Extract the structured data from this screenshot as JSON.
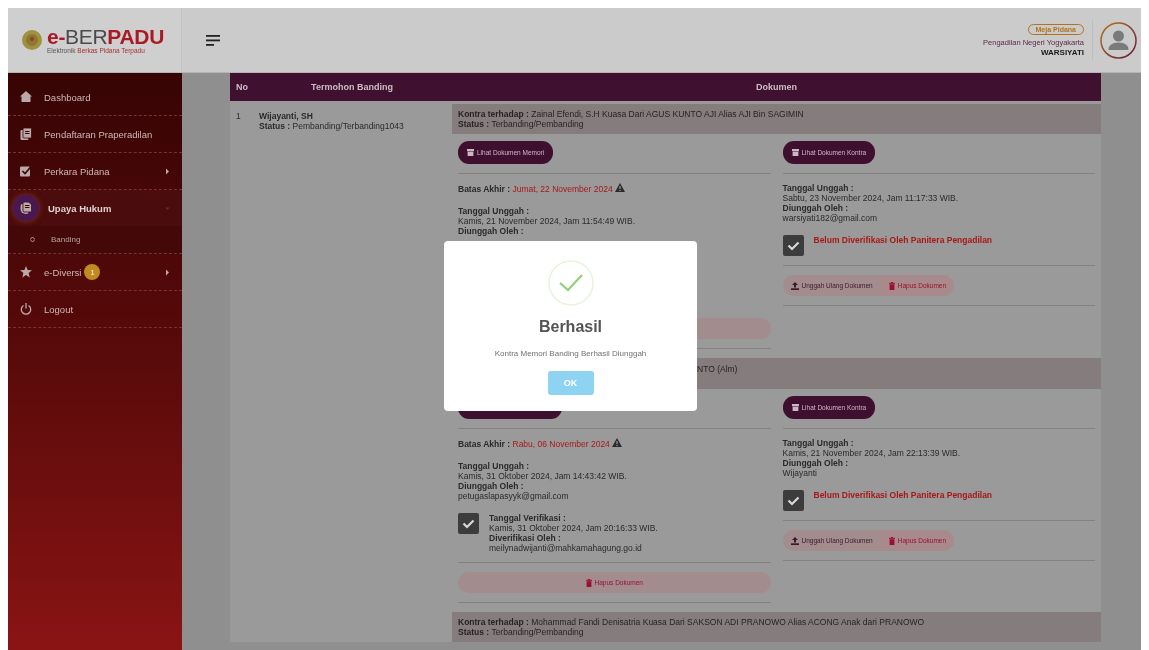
{
  "header": {
    "logo_title": [
      "e-",
      "BER",
      "PADU"
    ],
    "logo_subtitle": [
      "Elektronik ",
      "Berkas Pidana",
      " Terpadu"
    ],
    "role_badge": "Meja Pidana",
    "court": "Pengadilan Negeri Yogyakarta",
    "user": "WARSIYATI"
  },
  "sidebar": {
    "items": [
      {
        "label": "Dashboard",
        "kind": "home",
        "selected": false
      },
      {
        "label": "Pendaftaran Praperadilan",
        "kind": "docs",
        "selected": false
      },
      {
        "label": "Perkara Pidana",
        "kind": "edit",
        "selected": false,
        "expanded": false
      },
      {
        "label": "Upaya Hukum",
        "kind": "docs",
        "selected": true,
        "expanded": true,
        "children": [
          {
            "label": "Banding",
            "selected": false
          }
        ]
      },
      {
        "label": "e-Diversi",
        "kind": "star",
        "selected": false,
        "expanded": false,
        "badge": "1"
      },
      {
        "label": "Logout",
        "kind": "power",
        "selected": false
      }
    ]
  },
  "table": {
    "columns": [
      "No",
      "Termohon Banding",
      "Dokumen"
    ],
    "rows": [
      {
        "no": "1",
        "name": "Wijayanti, SH",
        "status_label": "Status :",
        "status": "Pembanding/Terbanding1043",
        "sections": [
          {
            "kontra_label": "Kontra terhadap :",
            "kontra": "Zainal Efendi, S.H Kuasa Dari AGUS KUNTO AJI Alias AJI Bin SAGIMIN",
            "status_label": "Status :",
            "status": "Terbanding/Pembanding",
            "memori": {
              "button": "Lihat Dokumen Memori",
              "deadline_label": "Batas Akhir :",
              "deadline": "Jumat, 22 November 2024",
              "upload_label": "Tanggal Unggah :",
              "upload": "Kamis, 21 November 2024, Jam 11:54:49 WIB.",
              "by_label": "Diunggah Oleh :",
              "delete_bar": true
            },
            "kontra_doc": {
              "button": "Lihat Dokumen Kontra",
              "upload_label": "Tanggal Unggah :",
              "upload": "Sabtu, 23 November 2024, Jam 11:17:33 WIB.",
              "by_label": "Diunggah Oleh :",
              "by": "warsiyati182@gmail.com",
              "unverified": "Belum Diverifikasi Oleh Panitera Pengadilan",
              "reupload": "Unggah Ulang Dokumen",
              "delete": "Hapus Dokumen"
            }
          },
          {
            "kontra": "NTO (Alm)",
            "obscured": true,
            "memori": {
              "deadline_label": "Batas Akhir :",
              "deadline": "Rabu, 06 November 2024",
              "upload_label": "Tanggal Unggah :",
              "upload": "Kamis, 31 Oktober 2024, Jam 14:43:42 WIB.",
              "by_label": "Diunggah Oleh :",
              "by": "petugaslapasyyk@gmail.com",
              "verify_label": "Tanggal Verifikasi :",
              "verify_date": "Kamis, 31 Oktober 2024, Jam 20:16:33 WIB.",
              "verifier_label": "Diverifikasi Oleh :",
              "verifier": "meilynadwijanti@mahkamahagung.go.id",
              "delete": "Hapus Dokumen"
            },
            "kontra_doc": {
              "button": "Lihat Dokumen Kontra",
              "upload_label": "Tanggal Unggah :",
              "upload": "Kamis, 21 November 2024, Jam 22:13:39 WIB.",
              "by_label": "Diunggah Oleh :",
              "by": "Wijayanti",
              "unverified": "Belum Diverifikasi Oleh Panitera Pengadilan",
              "reupload": "Unggah Ulang Dokumen",
              "delete": "Hapus Dokumen"
            }
          },
          {
            "kontra_label": "Kontra terhadap :",
            "kontra": "Mohammad Fandi Denisatria Kuasa Dari SAKSON ADI PRANOWO Alias ACONG Anak dari PRANOWO",
            "status_label": "Status :",
            "status": "Terbanding/Pembanding"
          }
        ]
      }
    ]
  },
  "modal": {
    "title": "Berhasil",
    "message": "Kontra Memori Banding Berhasil Diunggah",
    "button": "OK"
  }
}
